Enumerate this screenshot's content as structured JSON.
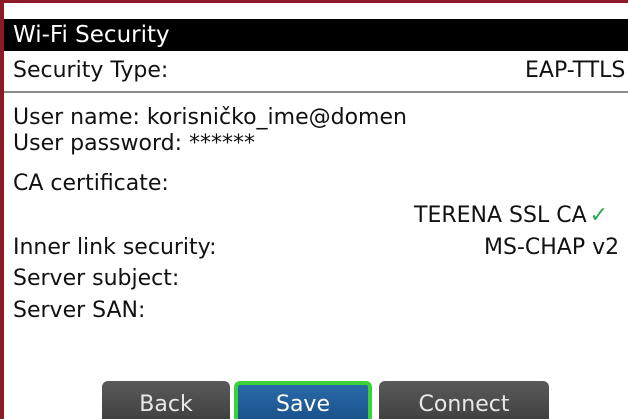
{
  "header": {
    "title": "Wi-Fi Security"
  },
  "security_type": {
    "label": "Security Type:",
    "value": "EAP-TTLS"
  },
  "fields": {
    "user_name": "User name: korisničko_ime@domen",
    "user_password": "User password: ******",
    "ca_certificate_label": "CA certificate:",
    "ca_certificate_value": "TERENA SSL CA",
    "inner_link_label": "Inner link security:",
    "inner_link_value": "MS-CHAP v2",
    "server_subject_label": "Server subject:",
    "server_san_label": "Server SAN:"
  },
  "buttons": {
    "back": "Back",
    "save": "Save",
    "connect": "Connect"
  },
  "icons": {
    "certificate_check": "checkmark-icon"
  },
  "colors": {
    "frame_border": "#8b1a26",
    "title_background": "#000000",
    "selected_button": "#1f5c98",
    "focus_outline": "#3ad13a",
    "check": "#2fa84f"
  }
}
